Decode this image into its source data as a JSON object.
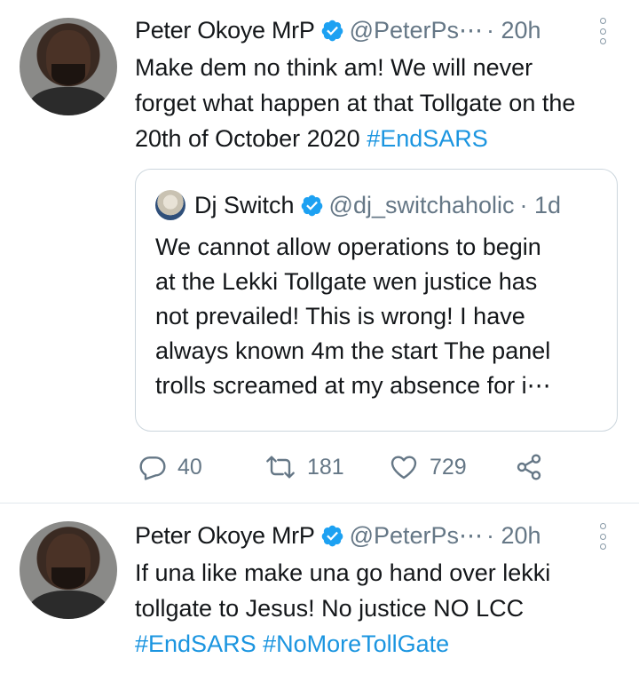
{
  "tweets": [
    {
      "author_name": "Peter Okoye MrP",
      "handle": "@PeterPs⋯",
      "time": "· 20h",
      "text_lines": [
        "Make dem no think am! We will never",
        "forget what happen at that Tollgate on the",
        "20th of October 2020 "
      ],
      "hashtag": "#EndSARS",
      "quoted": {
        "author_name": "Dj Switch",
        "handle": "@dj_switchaholic",
        "time": "· 1d",
        "text_lines": [
          "We cannot allow operations to begin",
          "at the Lekki Tollgate wen justice has",
          "not prevailed! This is wrong! I have",
          "always known 4m the start The panel",
          "trolls screamed at my absence for i⋯"
        ]
      },
      "actions": {
        "replies": "40",
        "retweets": "181",
        "likes": "729"
      }
    },
    {
      "author_name": "Peter Okoye MrP",
      "handle": "@PeterPs⋯",
      "time": "· 20h",
      "text_lines": [
        "If una like make una go hand over lekki",
        "tollgate to Jesus! No justice NO LCC"
      ],
      "hashtags": [
        "#EndSARS",
        "#NoMoreTollGate"
      ]
    }
  ],
  "colors": {
    "text": "#14171a",
    "muted": "#657786",
    "link": "#1b95e0",
    "verified": "#1da1f2",
    "border": "#ccd6dd"
  },
  "icons": {
    "verified": "verified-badge-icon",
    "more": "more-vertical-icon",
    "reply": "reply-icon",
    "retweet": "retweet-icon",
    "like": "heart-icon",
    "share": "share-icon"
  }
}
